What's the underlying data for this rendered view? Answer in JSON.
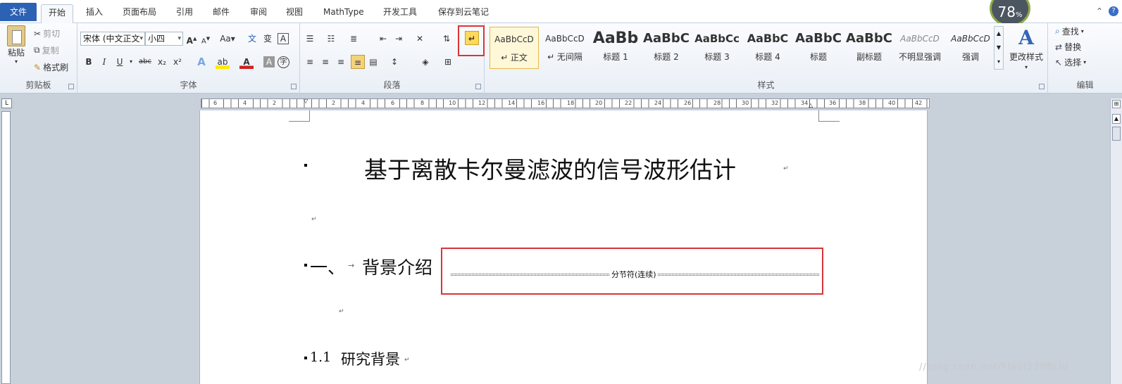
{
  "tabs": {
    "file": "文件",
    "items": [
      "开始",
      "插入",
      "页面布局",
      "引用",
      "邮件",
      "审阅",
      "视图",
      "MathType",
      "开发工具",
      "保存到云笔记"
    ]
  },
  "zoom_badge": {
    "value": "78",
    "unit": "%"
  },
  "clipboard": {
    "paste": "粘贴",
    "cut": "剪切",
    "copy": "复制",
    "format_painter": "格式刷",
    "label": "剪贴板"
  },
  "font": {
    "name": "宋体 (中文正文",
    "size": "小四",
    "grow": "A",
    "shrink": "A",
    "case": "Aa",
    "label": "字体",
    "bold": "B",
    "italic": "I",
    "underline": "U",
    "strike": "abc",
    "sub": "x₂",
    "sup": "x²"
  },
  "paragraph": {
    "label": "段落"
  },
  "styles": {
    "label": "样式",
    "items": [
      {
        "preview": "AaBbCcD",
        "name": "↵ 正文"
      },
      {
        "preview": "AaBbCcD",
        "name": "↵ 无间隔"
      },
      {
        "preview": "AaBb",
        "name": "标题 1"
      },
      {
        "preview": "AaBbC",
        "name": "标题 2"
      },
      {
        "preview": "AaBbCc",
        "name": "标题 3"
      },
      {
        "preview": "AaBbC",
        "name": "标题 4"
      },
      {
        "preview": "AaBbC",
        "name": "标题"
      },
      {
        "preview": "AaBbC",
        "name": "副标题"
      },
      {
        "preview": "AaBbCcD",
        "name": "不明显强调"
      },
      {
        "preview": "AaBbCcD",
        "name": "强调"
      }
    ],
    "change": "更改样式"
  },
  "editing": {
    "find": "查找",
    "replace": "替换",
    "select": "选择",
    "label": "编辑"
  },
  "ruler_numbers": [
    "6",
    "4",
    "2",
    "2",
    "4",
    "6",
    "8",
    "10",
    "12",
    "14",
    "16",
    "18",
    "20",
    "22",
    "24",
    "26",
    "28",
    "30",
    "32",
    "34",
    "36",
    "38",
    "40",
    "42"
  ],
  "document": {
    "title": "基于离散卡尔曼滤波的信号波形估计",
    "heading1_num": "一、",
    "heading1": "背景介绍",
    "section_break": "分节符(连续)",
    "heading2_num": "1.1",
    "heading2": "研究背景",
    "para_mark": "↵",
    "tab_arrow": "→"
  },
  "watermark": "//blog.csdn.net/Flabi2208Liu"
}
